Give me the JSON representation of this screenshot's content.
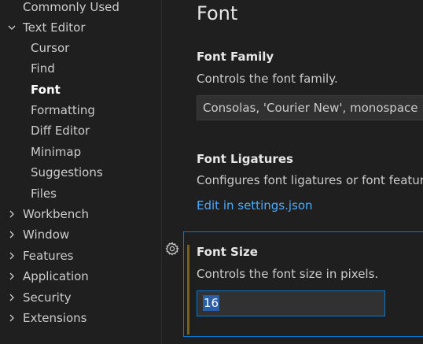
{
  "colors": {
    "background": "#1f1f1f",
    "link": "#4daafc",
    "focus_border": "#0078d4",
    "modified_indicator": "#7a5f22",
    "selection": "#2a5fa8"
  },
  "sidebar": {
    "items": [
      {
        "label": "Commonly Used",
        "level": 0,
        "chevron": "none"
      },
      {
        "label": "Text Editor",
        "level": 0,
        "chevron": "down"
      },
      {
        "label": "Cursor",
        "level": 1,
        "chevron": "none"
      },
      {
        "label": "Find",
        "level": 1,
        "chevron": "none"
      },
      {
        "label": "Font",
        "level": 1,
        "chevron": "none",
        "active": true
      },
      {
        "label": "Formatting",
        "level": 1,
        "chevron": "none"
      },
      {
        "label": "Diff Editor",
        "level": 1,
        "chevron": "none"
      },
      {
        "label": "Minimap",
        "level": 1,
        "chevron": "none"
      },
      {
        "label": "Suggestions",
        "level": 1,
        "chevron": "none"
      },
      {
        "label": "Files",
        "level": 1,
        "chevron": "none"
      },
      {
        "label": "Workbench",
        "level": 0,
        "chevron": "right"
      },
      {
        "label": "Window",
        "level": 0,
        "chevron": "right"
      },
      {
        "label": "Features",
        "level": 0,
        "chevron": "right"
      },
      {
        "label": "Application",
        "level": 0,
        "chevron": "right"
      },
      {
        "label": "Security",
        "level": 0,
        "chevron": "right"
      },
      {
        "label": "Extensions",
        "level": 0,
        "chevron": "right"
      }
    ]
  },
  "main": {
    "section_title": "Font",
    "font_family": {
      "title": "Font Family",
      "description": "Controls the font family.",
      "value": "Consolas, 'Courier New', monospace"
    },
    "font_ligatures": {
      "title": "Font Ligatures",
      "description": "Configures font ligatures or font features.",
      "link": "Edit in settings.json"
    },
    "font_size": {
      "title": "Font Size",
      "description": "Controls the font size in pixels.",
      "value": "16",
      "gear_icon": "gear-icon"
    }
  }
}
